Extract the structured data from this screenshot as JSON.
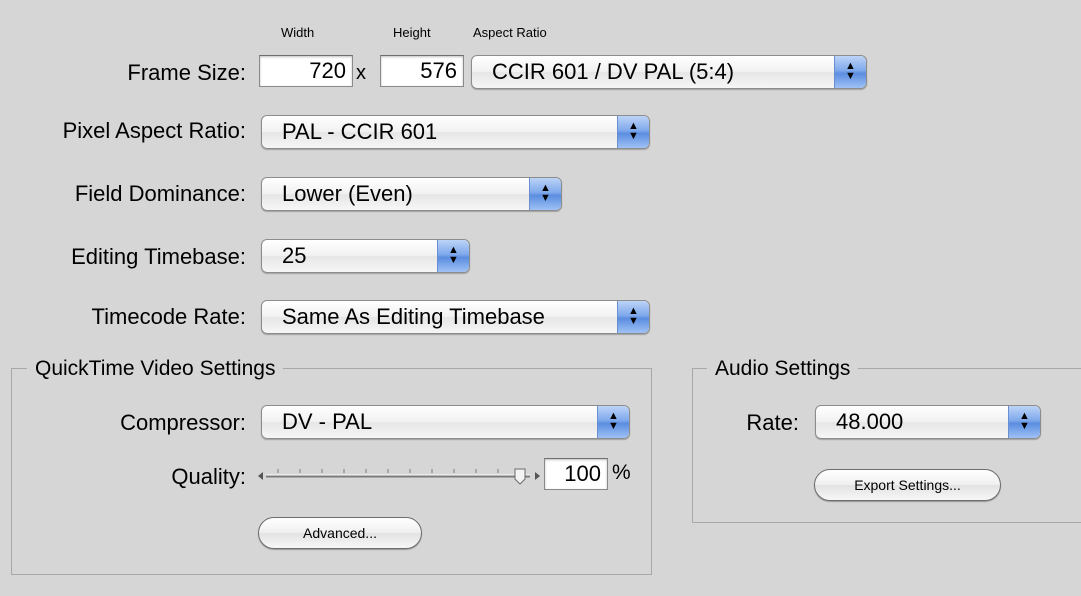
{
  "frame_size": {
    "label": "Frame Size:",
    "width_header": "Width",
    "height_header": "Height",
    "aspect_header": "Aspect Ratio",
    "width": "720",
    "separator": "x",
    "height": "576",
    "aspect_ratio": "CCIR 601 / DV PAL (5:4)"
  },
  "pixel_aspect_ratio": {
    "label": "Pixel Aspect Ratio:",
    "value": "PAL - CCIR 601"
  },
  "field_dominance": {
    "label": "Field Dominance:",
    "value": "Lower (Even)"
  },
  "editing_timebase": {
    "label": "Editing Timebase:",
    "value": "25"
  },
  "timecode_rate": {
    "label": "Timecode Rate:",
    "value": "Same As Editing Timebase"
  },
  "video": {
    "title": "QuickTime Video Settings",
    "compressor_label": "Compressor:",
    "compressor": "DV - PAL",
    "quality_label": "Quality:",
    "quality_value": "100",
    "quality_unit": "%",
    "quality_level": 1.0,
    "advanced_button": "Advanced..."
  },
  "audio": {
    "title": "Audio Settings",
    "rate_label": "Rate:",
    "rate": "48.000",
    "export_button": "Export Settings..."
  },
  "icons": {
    "popup": "up-down-arrows-icon",
    "slider": "slider-thumb-icon"
  }
}
